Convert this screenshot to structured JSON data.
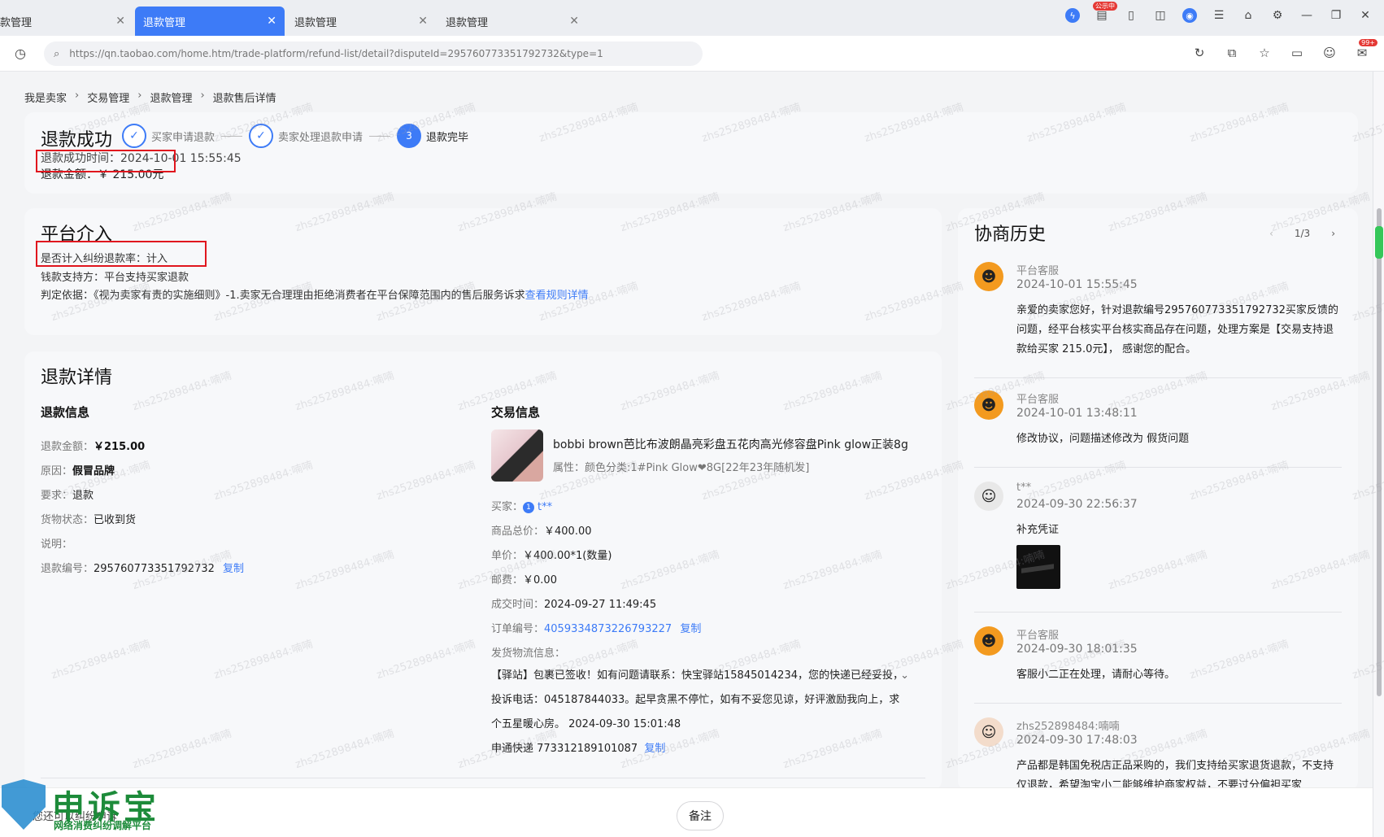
{
  "tabs": [
    {
      "label": "款管理",
      "active": false
    },
    {
      "label": "退款管理",
      "active": true
    },
    {
      "label": "退款管理",
      "active": false
    },
    {
      "label": "退款管理",
      "active": false
    }
  ],
  "window": {
    "publicity_badge": "公示中",
    "msg_badge": "99+"
  },
  "address": {
    "url": "https://qn.taobao.com/home.htm/trade-platform/refund-list/detail?disputeId=295760773351792732&type=1"
  },
  "breadcrumb": [
    "我是卖家",
    "交易管理",
    "退款管理",
    "退款售后详情"
  ],
  "status": {
    "title": "退款成功",
    "steps": [
      {
        "label": "买家申请退款",
        "num": ""
      },
      {
        "label": "卖家处理退款申请",
        "num": ""
      },
      {
        "label": "退款完毕",
        "num": "3"
      }
    ],
    "time": "退款成功时间：2024-10-01 15:55:45",
    "amount": "退款金额：￥ 215.00元"
  },
  "platform": {
    "title": "平台介入",
    "rate": "是否计入纠纷退款率：计入",
    "support": "钱款支持方：平台支持买家退款",
    "basis": "判定依据：《视为卖家有责的实施细则》-1.卖家无合理理由拒绝消费者在平台保障范围内的售后服务诉求",
    "rule_link": "查看规则详情"
  },
  "detail": {
    "title": "退款详情",
    "refund_info": {
      "heading": "退款信息",
      "amount_label": "退款金额：",
      "amount": "￥215.00",
      "reason_label": "原因：",
      "reason": "假冒品牌",
      "demand_label": "要求：",
      "demand": "退款",
      "goods_label": "货物状态：",
      "goods": "已收到货",
      "note_label": "说明：",
      "no_label": "退款编号：",
      "no": "295760773351792732",
      "copy": "复制"
    },
    "trade_info": {
      "heading": "交易信息",
      "product_title": "bobbi brown芭比布波朗晶亮彩盘五花肉高光修容盘Pink glow正装8g",
      "product_attr": "属性：颜色分类:1#Pink Glow❤8G[22年23年随机发]",
      "buyer_label": "买家：",
      "buyer": "t**",
      "total_label": "商品总价：",
      "total": "￥400.00",
      "unit_label": "单价：",
      "unit": "￥400.00*1(数量)",
      "post_label": "邮费：",
      "post": "￥0.00",
      "deal_label": "成交时间：",
      "deal": "2024-09-27 11:49:45",
      "order_label": "订单编号：",
      "order": "4059334873226793227",
      "copy": "复制",
      "logistics_label": "发货物流信息：",
      "logistics_text": "【驿站】包裹已签收！如有问题请联系：快宝驿站15845014234，您的快递已经妥投，投诉电话：045187844033。起早贪黑不停忙，如有不妥您见谅，好评激励我向上，求个五星暖心房。 2024-09-30 15:01:48",
      "express": "申通快递 773312189101087",
      "express_copy": "复制"
    }
  },
  "history": {
    "title": "协商历史",
    "page": "1/3",
    "items": [
      {
        "name": "平台客服",
        "time": "2024-10-01 15:55:45",
        "text": "亲爱的卖家您好，针对退款编号295760773351792732买家反馈的问题，经平台核实平台核实商品存在问题，处理方案是【交易支持退款给买家 215.0元】，  感谢您的配合。"
      },
      {
        "name": "平台客服",
        "time": "2024-10-01 13:48:11",
        "text": "修改协议，问题描述修改为  假货问题"
      },
      {
        "name": "t**",
        "time": "2024-09-30 22:56:37",
        "text": "补充凭证"
      },
      {
        "name": "平台客服",
        "time": "2024-09-30 18:01:35",
        "text": "客服小二正在处理，请耐心等待。"
      },
      {
        "name": "zhs252898484:喃喃",
        "time": "2024-09-30 17:48:03",
        "text": "产品都是韩国免税店正品采购的，我们支持给买家退货退款，不支持仅退款，希望淘宝小二能够维护商家权益，不要过分偏袒买家"
      }
    ]
  },
  "bottom": {
    "remark": "备注",
    "hint": "您还可以纠纷申诉"
  },
  "logo": {
    "name": "申诉宝",
    "slogan": "网络消费纠纷调解平台"
  },
  "watermark": "zhs252898484:喃喃"
}
